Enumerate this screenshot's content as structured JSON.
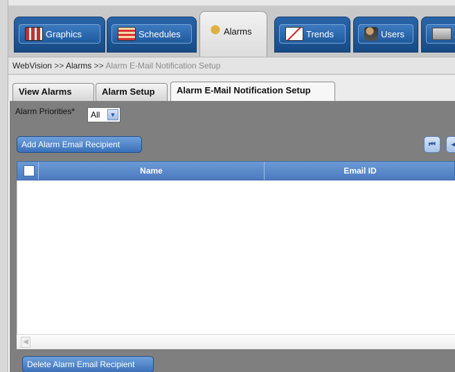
{
  "main_tabs": [
    {
      "label": "Graphics",
      "icon": "graphics-icon"
    },
    {
      "label": "Schedules",
      "icon": "calendar-icon"
    },
    {
      "label": "Alarms",
      "icon": "bell-icon",
      "active": true
    },
    {
      "label": "Trends",
      "icon": "trend-chart-icon"
    },
    {
      "label": "Users",
      "icon": "users-icon"
    },
    {
      "label": "",
      "icon": "printer-icon"
    }
  ],
  "breadcrumb": {
    "root": "WebVision",
    "separator": ">>",
    "level1": "Alarms",
    "current": "Alarm E-Mail Notification Setup"
  },
  "sub_tabs": [
    {
      "label": "View Alarms"
    },
    {
      "label": "Alarm Setup"
    },
    {
      "label": "Alarm E-Mail Notification Setup",
      "active": true
    }
  ],
  "filter": {
    "priorities_label": "Alarm Priorities*",
    "priorities_value": "All"
  },
  "actions": {
    "add_label": "Add Alarm Email Recipient",
    "delete_label": "Delete Alarm Email Recipient"
  },
  "grid": {
    "columns": [
      "Name",
      "Email ID"
    ],
    "rows": []
  },
  "colors": {
    "tab_blue": "#1f5a9e",
    "header_blue": "#5a89c9",
    "panel_gray": "#7f7f7f"
  }
}
